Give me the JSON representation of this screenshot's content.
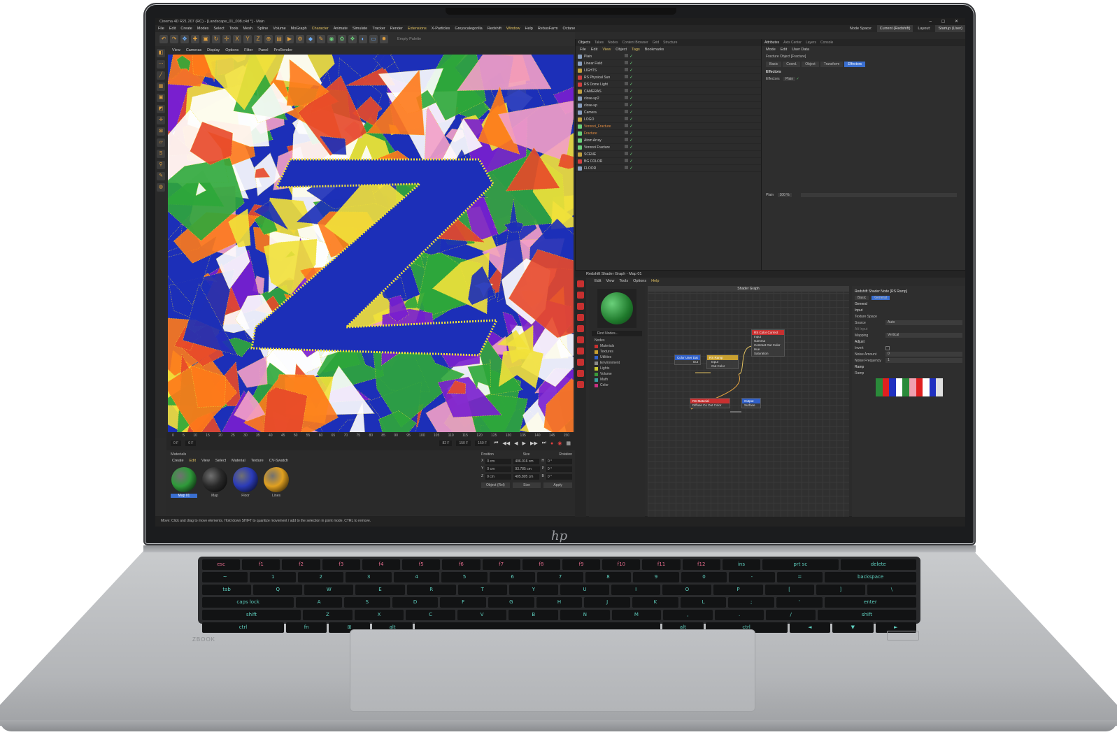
{
  "window": {
    "title": "Cinema 4D R21.207 (RC) - [Landscape_01_008.c4d *] - Main",
    "controls": "–  ▢  ✕"
  },
  "menubar": {
    "items": [
      "File",
      "Edit",
      "Create",
      "Modes",
      "Select",
      "Tools",
      "Mesh",
      "Spline",
      "Volume",
      "MoGraph",
      "Character",
      "Animate",
      "Simulate",
      "Tracker",
      "Render",
      "Extensions",
      "X-Particles",
      "Greyscalegorilla",
      "Redshift",
      "Window",
      "Help",
      "RebusFarm",
      "Octane"
    ],
    "node_space_label": "Node Space:",
    "node_space_value": "Current (Redshift)",
    "layout_label": "Layout:",
    "layout_value": "Startup (User)"
  },
  "toolbar": {
    "empty_palette": "Empty Palette"
  },
  "viewport": {
    "menu": [
      "View",
      "Cameras",
      "Display",
      "Options",
      "Filter",
      "Panel",
      "ProRender"
    ],
    "art_colors": [
      "#1c2fb8",
      "#2ea83a",
      "#e8492a",
      "#f4a0c8",
      "#f2e23a",
      "#7a1fd0",
      "#ffffff",
      "#ff7a1a"
    ]
  },
  "timeline": {
    "ticks": [
      "0",
      "5",
      "10",
      "15",
      "20",
      "25",
      "30",
      "35",
      "40",
      "45",
      "50",
      "55",
      "60",
      "65",
      "70",
      "75",
      "80",
      "85",
      "90",
      "95",
      "100",
      "105",
      "110",
      "115",
      "120",
      "125",
      "130",
      "135",
      "140",
      "145",
      "150"
    ],
    "current_frame": "82 F",
    "start": "0 F",
    "min": "0 F",
    "end": "150 F",
    "max": "150 F"
  },
  "materials": {
    "title": "Materials",
    "menu": [
      "Create",
      "Edit",
      "View",
      "Select",
      "Material",
      "Texture",
      "CV-Swatch"
    ],
    "items": [
      {
        "label": "Map 01",
        "color": "#2f9a3a"
      },
      {
        "label": "Map",
        "color": "#2a2a2a"
      },
      {
        "label": "Floor",
        "color": "#2b3bb8"
      },
      {
        "label": "Lines",
        "color": "#e0a020"
      }
    ]
  },
  "coords": {
    "headers": [
      "Position",
      "Size",
      "Rotation"
    ],
    "rows": [
      {
        "axis": "X",
        "pos": "0 cm",
        "size": "406.016 cm",
        "rlabel": "H",
        "rot": "0 °"
      },
      {
        "axis": "Y",
        "pos": "0 cm",
        "size": "93.785 cm",
        "rlabel": "P",
        "rot": "0 °"
      },
      {
        "axis": "Z",
        "pos": "0 cm",
        "size": "405.805 cm",
        "rlabel": "B",
        "rot": "0 °"
      }
    ],
    "mode": "Object (Rel)",
    "size_mode": "Size",
    "apply": "Apply"
  },
  "status": "Move: Click and drag to move elements. Hold down SHIFT to quantize movement / add to the selection in point mode, CTRL to remove.",
  "objects": {
    "tabs": [
      "Objects",
      "Takes",
      "Nodes",
      "Content Browser",
      "Grid",
      "Structure"
    ],
    "menu": [
      "File",
      "Edit",
      "View",
      "Object",
      "Tags",
      "Bookmarks"
    ],
    "items": [
      {
        "name": "Plain",
        "color": "#8aa0c0",
        "sel": false
      },
      {
        "name": "Linear Field",
        "color": "#8aa0c0",
        "sel": false
      },
      {
        "name": "LIGHTS",
        "color": "#c0a040",
        "sel": false
      },
      {
        "name": "RS Physical Sun",
        "color": "#d04040",
        "sel": false
      },
      {
        "name": "RS Dome Light",
        "color": "#d04040",
        "sel": false
      },
      {
        "name": "CAMERAS",
        "color": "#c0a040",
        "sel": false
      },
      {
        "name": "close-up2",
        "color": "#8aa0c0",
        "sel": false
      },
      {
        "name": "close-up",
        "color": "#8aa0c0",
        "sel": false
      },
      {
        "name": "Camera",
        "color": "#8aa0c0",
        "sel": false
      },
      {
        "name": "LOGO",
        "color": "#c0a040",
        "sel": false
      },
      {
        "name": "Voronoi_Fracture",
        "color": "#6ad07a",
        "sel": true
      },
      {
        "name": "Fracture",
        "color": "#6ad07a",
        "sel": true
      },
      {
        "name": "Atom Array",
        "color": "#6ad07a",
        "sel": false
      },
      {
        "name": "Voronoi Fracture",
        "color": "#6ad07a",
        "sel": false
      },
      {
        "name": "SCENE",
        "color": "#c0a040",
        "sel": false
      },
      {
        "name": "BG COLOR",
        "color": "#d04040",
        "sel": false
      },
      {
        "name": "FLOOR",
        "color": "#8aa0c0",
        "sel": false
      }
    ]
  },
  "attributes": {
    "tabs": [
      "Attributes",
      "Axis Center",
      "Layers",
      "Console"
    ],
    "menu": [
      "Mode",
      "Edit",
      "User Data"
    ],
    "object_title": "Fracture Object [Fracture]",
    "sub_tabs": [
      "Basic",
      "Coord.",
      "Object",
      "Transform",
      "Effectors"
    ],
    "section": "Effectors",
    "effectors_label": "Effectors",
    "effectors_value": "Plain",
    "plain_label": "Plain",
    "plain_value": "100 %"
  },
  "shader": {
    "title": "Redshift Shader Graph - Map 01",
    "menu": [
      "Edit",
      "View",
      "Tools",
      "Options",
      "Help"
    ],
    "find": "Find Nodes...",
    "nodes_label": "Nodes",
    "categories": [
      {
        "name": "Materials",
        "color": "#c83030"
      },
      {
        "name": "Textures",
        "color": "#c8a030"
      },
      {
        "name": "Utilities",
        "color": "#3060c8"
      },
      {
        "name": "Environment",
        "color": "#8a8a8a"
      },
      {
        "name": "Lights",
        "color": "#c8c830"
      },
      {
        "name": "Volume",
        "color": "#3a9a3a"
      },
      {
        "name": "Math",
        "color": "#3aa0a0"
      },
      {
        "name": "Color",
        "color": "#c83080"
      }
    ],
    "graph_title": "Shader Graph",
    "graph_nodes": {
      "color_user": {
        "title": "Color User Dat",
        "out": "Out"
      },
      "ramp": {
        "title": "RS Ramp",
        "ports": [
          "Input",
          "Out Color"
        ]
      },
      "color_correct": {
        "title": "RS Color Correct",
        "ports": [
          "Input",
          "Gamma",
          "Contrast Out Color",
          "Hue",
          "Saturation"
        ]
      },
      "material": {
        "title": "RS Material",
        "ports": [
          "Diffuse Co Out Color"
        ]
      },
      "output": {
        "title": "Output",
        "ports": [
          "Surface"
        ]
      }
    },
    "node_panel": {
      "title": "Redshift Shader Node [RS Ramp]",
      "tabs": [
        "Basic",
        "General"
      ],
      "general": "General",
      "input": "Input",
      "texture_space": "Texture Space",
      "source_label": "Source",
      "source_value": "Auto",
      "alt_input_label": "Alt Input",
      "mapping_label": "Mapping",
      "mapping_value": "Vertical",
      "adjust": "Adjust",
      "invert_label": "Invert",
      "noise_amount_label": "Noise Amount",
      "noise_amount_value": "0",
      "noise_freq_label": "Noise Frequency",
      "noise_freq_value": "1",
      "ramp_section": "Ramp",
      "ramp_label": "Ramp",
      "ramp_colors": [
        "#2a8a3a",
        "#e02020",
        "#2030c0",
        "#ffffff",
        "#2a8a3a",
        "#f0a0b0",
        "#e02020",
        "#ffffff",
        "#2030c0",
        "#e0e0e0"
      ]
    }
  },
  "keyboard": {
    "rows": [
      [
        "esc",
        "f1",
        "f2",
        "f3",
        "f4",
        "f5",
        "f6",
        "f7",
        "f8",
        "f9",
        "f10",
        "f11",
        "f12",
        "ins",
        "prt sc",
        "delete"
      ],
      [
        "~",
        "1",
        "2",
        "3",
        "4",
        "5",
        "6",
        "7",
        "8",
        "9",
        "0",
        "-",
        "=",
        "backspace"
      ],
      [
        "tab",
        "Q",
        "W",
        "E",
        "R",
        "T",
        "Y",
        "U",
        "I",
        "O",
        "P",
        "[",
        "]",
        "\\"
      ],
      [
        "caps lock",
        "A",
        "S",
        "D",
        "F",
        "G",
        "H",
        "J",
        "K",
        "L",
        ";",
        "'",
        "enter"
      ],
      [
        "shift",
        "Z",
        "X",
        "C",
        "V",
        "B",
        "N",
        "M",
        ",",
        ".",
        "/",
        "shift"
      ],
      [
        "ctrl",
        "fn",
        "⊞",
        "alt",
        "",
        "alt",
        "ctrl",
        "◄",
        "▼",
        "►"
      ]
    ]
  },
  "brand": {
    "hp": "hp",
    "series": "ZBOOK"
  }
}
